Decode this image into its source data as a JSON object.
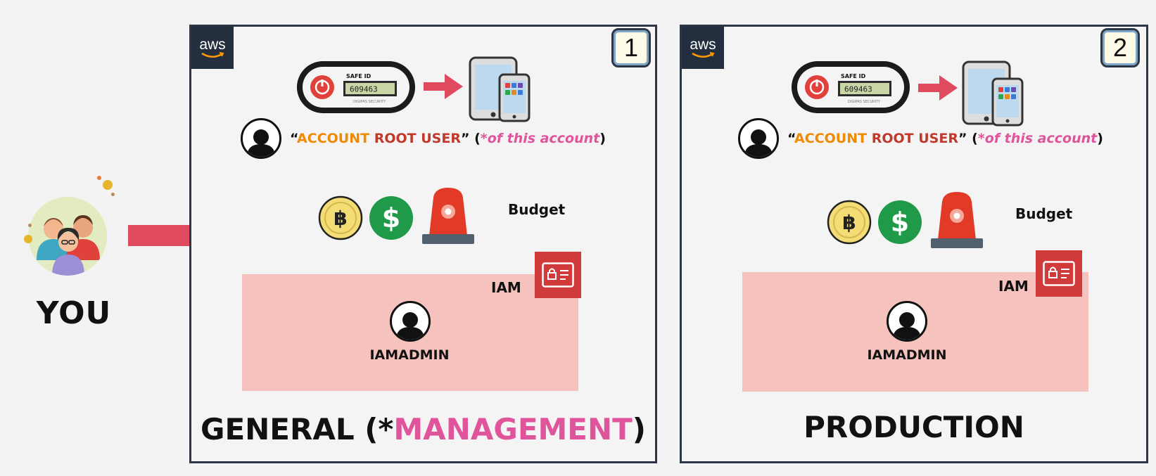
{
  "you": {
    "label": "YOU"
  },
  "accounts": [
    {
      "number": "1",
      "aws_logo": "aws",
      "root_user": {
        "quote_open": "“",
        "account": "ACCOUNT",
        "root": "ROOT USER",
        "quote_close": "”",
        "paren_open": "(",
        "note": "*of this account",
        "paren_close": ")"
      },
      "token": {
        "brand": "SAFE ID",
        "code": "609463",
        "sub": "DIGIPAS SECURITY"
      },
      "budget_label": "Budget",
      "iam_label": "IAM",
      "admin_label": "IAMADMIN",
      "title_prefix": "GENERAL (*",
      "title_highlight": "MANAGEMENT",
      "title_suffix": ")"
    },
    {
      "number": "2",
      "aws_logo": "aws",
      "root_user": {
        "quote_open": "“",
        "account": "ACCOUNT",
        "root": "ROOT USER",
        "quote_close": "”",
        "paren_open": "(",
        "note": "*of this account",
        "paren_close": ")"
      },
      "token": {
        "brand": "SAFE ID",
        "code": "609463",
        "sub": "DIGIPAS SECURITY"
      },
      "budget_label": "Budget",
      "iam_label": "IAM",
      "admin_label": "IAMADMIN",
      "title": "PRODUCTION"
    }
  ],
  "colors": {
    "aws_dark": "#232f3e",
    "arrow": "#e04a5f",
    "iam_fill": "#f5c2bd",
    "iam_icon": "#d13a3a",
    "highlight": "#e0549b"
  },
  "icons": [
    "people-group-icon",
    "mfa-token-icon",
    "mobile-devices-icon",
    "user-icon",
    "coin-icon",
    "dollar-icon",
    "alarm-light-icon",
    "iam-badge-icon"
  ]
}
